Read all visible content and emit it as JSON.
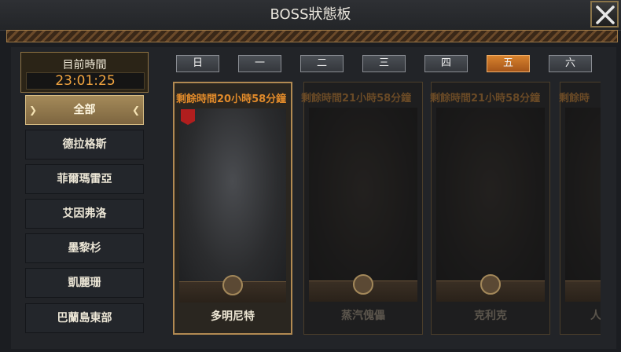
{
  "window": {
    "title": "BOSS狀態板"
  },
  "clock": {
    "label": "目前時間",
    "value": "23:01:25"
  },
  "zones": [
    {
      "label": "全部",
      "active": true
    },
    {
      "label": "德拉格斯",
      "active": false
    },
    {
      "label": "菲爾瑪雷亞",
      "active": false
    },
    {
      "label": "艾因弗洛",
      "active": false
    },
    {
      "label": "墨黎杉",
      "active": false
    },
    {
      "label": "凱麗珊",
      "active": false
    },
    {
      "label": "巴蘭島東部",
      "active": false
    }
  ],
  "days": [
    {
      "label": "日",
      "active": false
    },
    {
      "label": "一",
      "active": false
    },
    {
      "label": "二",
      "active": false
    },
    {
      "label": "三",
      "active": false
    },
    {
      "label": "四",
      "active": false
    },
    {
      "label": "五",
      "active": true
    },
    {
      "label": "六",
      "active": false
    }
  ],
  "bosses": [
    {
      "remaining": "剩餘時間20小時58分鐘",
      "name": "多明尼特",
      "active": true
    },
    {
      "remaining": "剩餘時間21小時58分鐘",
      "name": "蒸汽傀儡",
      "active": false
    },
    {
      "remaining": "剩餘時間21小時58分鐘",
      "name": "克利克",
      "active": false
    },
    {
      "remaining": "剩餘時",
      "name": "人",
      "active": false
    }
  ],
  "colors": {
    "accent": "#e08a2a",
    "active_tab": "#c36d24",
    "gold_border": "#b28a52"
  },
  "icons": {
    "close": "close-icon",
    "emblem": "boss-emblem-icon",
    "mark": "red-mark-icon"
  }
}
